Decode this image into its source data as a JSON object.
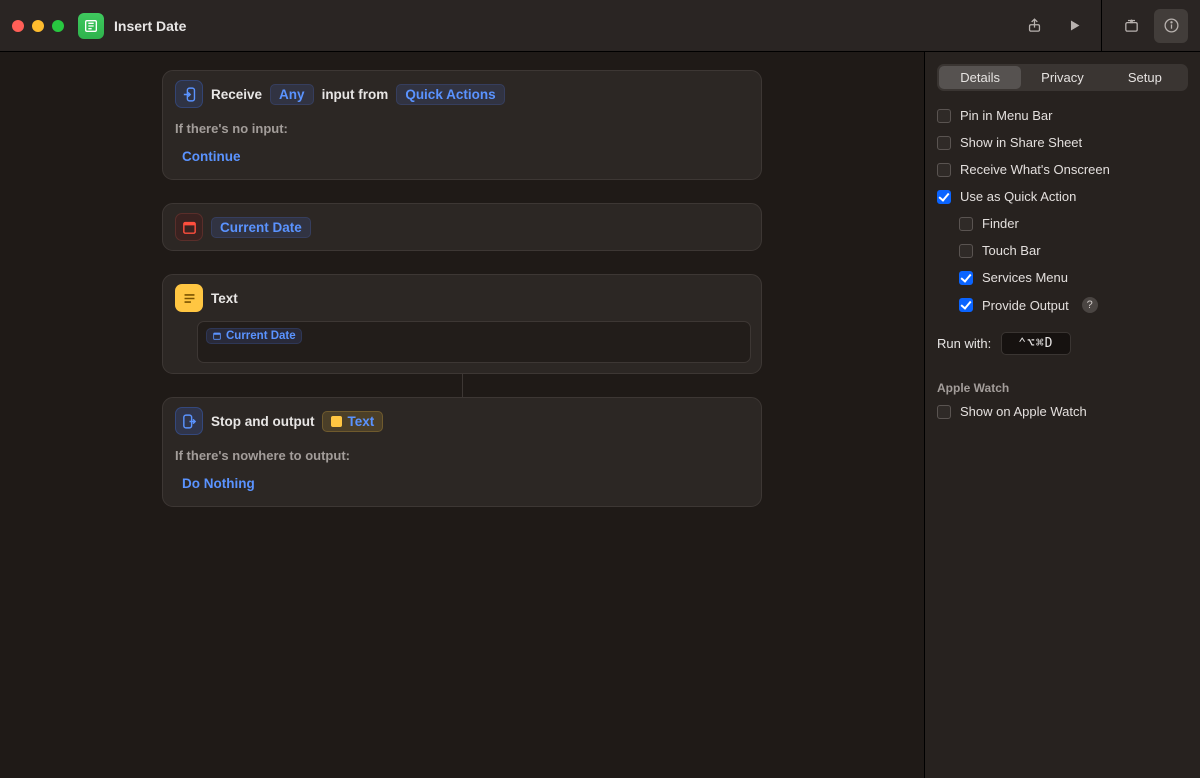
{
  "window": {
    "title": "Insert Date"
  },
  "workflow": {
    "receive": {
      "prefix": "Receive",
      "any": "Any",
      "mid": "input from",
      "source": "Quick Actions",
      "noinput_label": "If there's no input:",
      "noinput_action": "Continue"
    },
    "date": {
      "label": "Current Date"
    },
    "text": {
      "label": "Text",
      "field_token": "Current Date"
    },
    "output": {
      "prefix": "Stop and output",
      "chip": "Text",
      "nowhere_label": "If there's nowhere to output:",
      "nowhere_action": "Do Nothing"
    }
  },
  "sidebar": {
    "tabs": {
      "details": "Details",
      "privacy": "Privacy",
      "setup": "Setup"
    },
    "options": {
      "pin_menubar": "Pin in Menu Bar",
      "share_sheet": "Show in Share Sheet",
      "receive_onscreen": "Receive What's Onscreen",
      "quick_action": "Use as Quick Action",
      "finder": "Finder",
      "touchbar": "Touch Bar",
      "services_menu": "Services Menu",
      "provide_output": "Provide Output"
    },
    "checked": {
      "pin_menubar": false,
      "share_sheet": false,
      "receive_onscreen": false,
      "quick_action": true,
      "finder": false,
      "touchbar": false,
      "services_menu": true,
      "provide_output": true,
      "apple_watch": false
    },
    "runwith_label": "Run with:",
    "shortcut": "⌃⌥⌘D",
    "apple_watch_section": "Apple Watch",
    "apple_watch_option": "Show on Apple Watch",
    "help": "?"
  }
}
